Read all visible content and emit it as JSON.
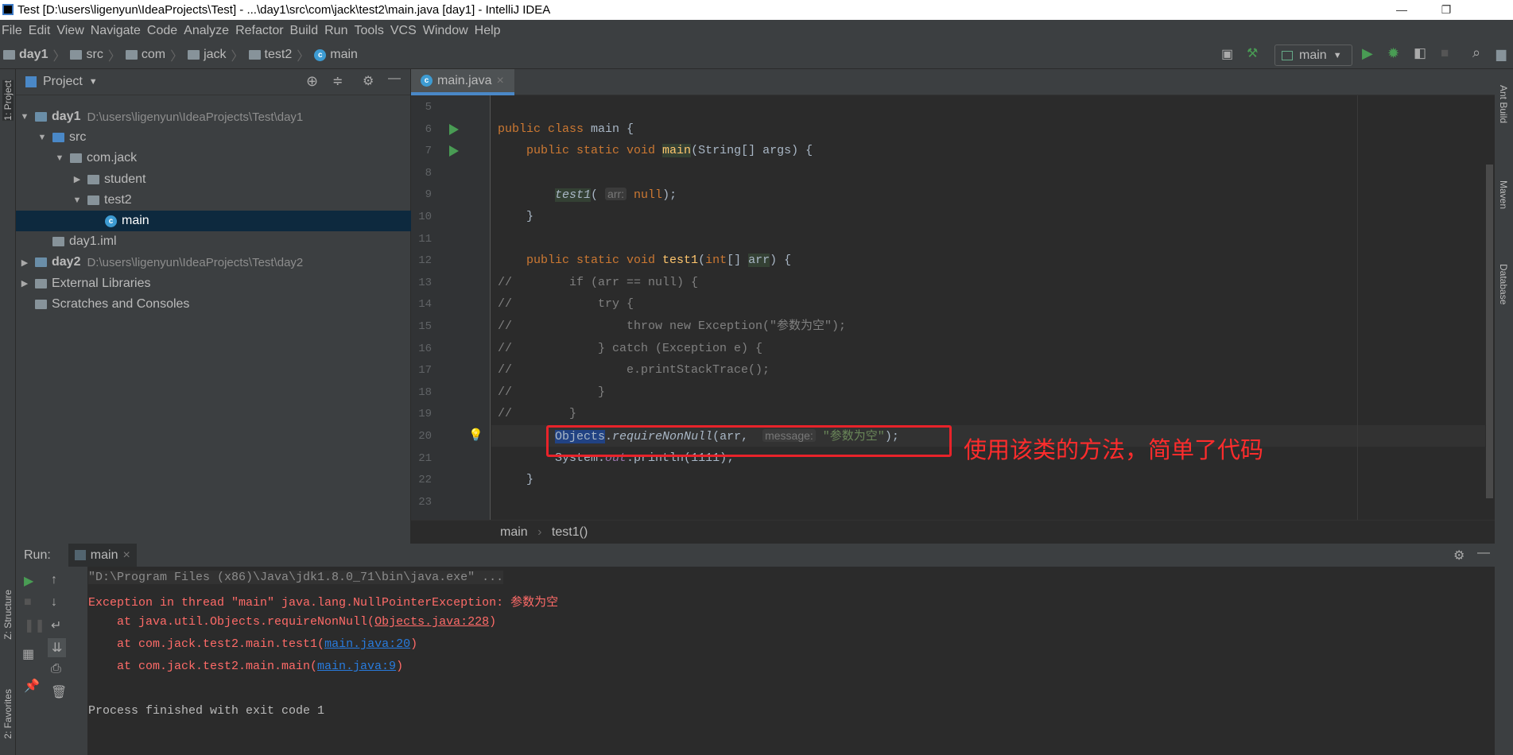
{
  "window": {
    "title": "Test [D:\\users\\ligenyun\\IdeaProjects\\Test] - ...\\day1\\src\\com\\jack\\test2\\main.java [day1] - IntelliJ IDEA",
    "minimize": "—",
    "maximize": "❐"
  },
  "menu": [
    "File",
    "Edit",
    "View",
    "Navigate",
    "Code",
    "Analyze",
    "Refactor",
    "Build",
    "Run",
    "Tools",
    "VCS",
    "Window",
    "Help"
  ],
  "breadcrumb": [
    "day1",
    "src",
    "com",
    "jack",
    "test2",
    "main"
  ],
  "toolbar": {
    "run_config": "main"
  },
  "left_stripe": {
    "project": "1: Project",
    "structure": "Z: Structure",
    "favorites": "2: Favorites"
  },
  "right_stripe": [
    "Ant Build",
    "Maven",
    "Database"
  ],
  "project": {
    "title": "Project",
    "items": [
      {
        "label": "day1",
        "path": "D:\\users\\ligenyun\\IdeaProjects\\Test\\day1",
        "level": 0,
        "arrow": "▼",
        "icon": "module",
        "bold": true
      },
      {
        "label": "src",
        "level": 1,
        "arrow": "▼",
        "icon": "folder-src"
      },
      {
        "label": "com.jack",
        "level": 2,
        "arrow": "▼",
        "icon": "package"
      },
      {
        "label": "student",
        "level": 3,
        "arrow": "▶",
        "icon": "package"
      },
      {
        "label": "test2",
        "level": 3,
        "arrow": "▼",
        "icon": "package"
      },
      {
        "label": "main",
        "level": 4,
        "arrow": "",
        "icon": "class",
        "selected": true
      },
      {
        "label": "day1.iml",
        "level": 1,
        "arrow": "",
        "icon": "iml"
      },
      {
        "label": "day2",
        "path": "D:\\users\\ligenyun\\IdeaProjects\\Test\\day2",
        "level": 0,
        "arrow": "▶",
        "icon": "module",
        "bold": true
      },
      {
        "label": "External Libraries",
        "level": 0,
        "arrow": "▶",
        "icon": "libraries"
      },
      {
        "label": "Scratches and Consoles",
        "level": 0,
        "arrow": "",
        "icon": "scratches"
      }
    ]
  },
  "editor": {
    "tab": "main.java",
    "tab_close": "×",
    "lines": [
      {
        "n": "5",
        "seg": []
      },
      {
        "n": "6",
        "seg": [
          [
            "public class ",
            "kw"
          ],
          [
            "main {",
            ""
          ]
        ]
      },
      {
        "n": "7",
        "seg": [
          [
            "    public static void ",
            "kw"
          ],
          [
            "main",
            "mt hl"
          ],
          [
            "(String[] args) {",
            ""
          ]
        ]
      },
      {
        "n": "8",
        "seg": []
      },
      {
        "n": "9",
        "seg": [
          [
            "        ",
            ""
          ],
          [
            "test1",
            "it hl"
          ],
          [
            "( ",
            ""
          ],
          [
            "arr:",
            "hint"
          ],
          [
            " null",
            "kw"
          ],
          [
            ");",
            ""
          ]
        ]
      },
      {
        "n": "10",
        "seg": [
          [
            "    }",
            ""
          ]
        ]
      },
      {
        "n": "11",
        "seg": []
      },
      {
        "n": "12",
        "seg": [
          [
            "    public static void ",
            "kw"
          ],
          [
            "test1",
            "mt"
          ],
          [
            "(",
            ""
          ],
          [
            "int",
            "kw"
          ],
          [
            "[] ",
            ""
          ],
          [
            "arr",
            "hl"
          ],
          [
            ") {",
            ""
          ]
        ]
      },
      {
        "n": "13",
        "seg": [
          [
            "//        if (arr == null) {",
            "cm"
          ]
        ]
      },
      {
        "n": "14",
        "seg": [
          [
            "//            try {",
            "cm"
          ]
        ]
      },
      {
        "n": "15",
        "seg": [
          [
            "//                throw new Exception(\"参数为空\");",
            "cm"
          ]
        ]
      },
      {
        "n": "16",
        "seg": [
          [
            "//            } catch (Exception e) {",
            "cm"
          ]
        ]
      },
      {
        "n": "17",
        "seg": [
          [
            "//                e.printStackTrace();",
            "cm"
          ]
        ]
      },
      {
        "n": "18",
        "seg": [
          [
            "//            }",
            "cm"
          ]
        ]
      },
      {
        "n": "19",
        "seg": [
          [
            "//        }",
            "cm"
          ]
        ]
      },
      {
        "n": "20",
        "seg": [
          [
            "        ",
            ""
          ],
          [
            "Objects",
            "sel2"
          ],
          [
            ".",
            ""
          ],
          [
            "requireNonNull",
            "it"
          ],
          [
            "(arr,  ",
            ""
          ],
          [
            "message:",
            "hint"
          ],
          [
            " \"参数为空\"",
            "st"
          ],
          [
            ");",
            ""
          ]
        ]
      },
      {
        "n": "21",
        "seg": [
          [
            "        System.",
            ""
          ],
          [
            "out",
            "fld"
          ],
          [
            ".println(",
            ""
          ],
          [
            "1111",
            "num"
          ],
          [
            ");",
            ""
          ]
        ]
      },
      {
        "n": "22",
        "seg": [
          [
            "    }",
            ""
          ]
        ]
      },
      {
        "n": "23",
        "seg": []
      }
    ],
    "crumbs": [
      "main",
      "test1()"
    ]
  },
  "annotation": "使用该类的方法，简单了代码",
  "run": {
    "label": "Run:",
    "tab": "main",
    "tab_close": "×",
    "lines": [
      {
        "seg": [
          [
            "\"D:\\Program Files (x86)\\Java\\jdk1.8.0_71\\bin\\java.exe\" ...",
            "cmd"
          ]
        ]
      },
      {
        "seg": [
          [
            "Exception in thread \"main\" java.lang.NullPointerException: 参数为空",
            "err"
          ]
        ]
      },
      {
        "seg": [
          [
            "    at java.util.Objects.requireNonNull(",
            "err"
          ],
          [
            "Objects.java:228",
            "err ulk"
          ],
          [
            ")",
            "err"
          ]
        ]
      },
      {
        "seg": [
          [
            "    at com.jack.test2.main.test1(",
            "err"
          ],
          [
            "main.java:20",
            "lnk"
          ],
          [
            ")",
            "err"
          ]
        ]
      },
      {
        "seg": [
          [
            "    at com.jack.test2.main.main(",
            "err"
          ],
          [
            "main.java:9",
            "lnk"
          ],
          [
            ")",
            "err"
          ]
        ]
      },
      {
        "seg": []
      },
      {
        "seg": [
          [
            "Process finished with exit code 1",
            ""
          ]
        ]
      }
    ]
  }
}
